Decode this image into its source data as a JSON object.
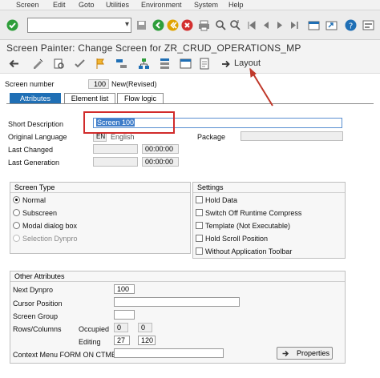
{
  "menu": [
    "Screen",
    "Edit",
    "Goto",
    "Utilities",
    "Environment",
    "System",
    "Help"
  ],
  "window_title": "Screen Painter: Change Screen for ZR_CRUD_OPERATIONS_MP",
  "toolbar2": {
    "layout_label": "Layout"
  },
  "header": {
    "screen_number_label": "Screen number",
    "screen_number_value": "100",
    "screen_status": "New(Revised)"
  },
  "tabs": [
    {
      "label": "Attributes",
      "active": true
    },
    {
      "label": "Element list",
      "active": false
    },
    {
      "label": "Flow logic",
      "active": false
    }
  ],
  "attributes": {
    "short_description_label": "Short Description",
    "short_description_value": "Screen 100",
    "original_language_label": "Original Language",
    "original_language_code": "EN",
    "original_language_name": "English",
    "package_label": "Package",
    "package_value": "",
    "last_changed_label": "Last Changed",
    "last_changed_date": "",
    "last_changed_time": "00:00:00",
    "last_generation_label": "Last Generation",
    "last_generation_date": "",
    "last_generation_time": "00:00:00"
  },
  "screen_type": {
    "title": "Screen Type",
    "options": [
      {
        "label": "Normal",
        "selected": true,
        "enabled": true
      },
      {
        "label": "Subscreen",
        "selected": false,
        "enabled": true
      },
      {
        "label": "Modal dialog box",
        "selected": false,
        "enabled": true
      },
      {
        "label": "Selection Dynpro",
        "selected": false,
        "enabled": false
      }
    ]
  },
  "settings": {
    "title": "Settings",
    "options": [
      {
        "label": "Hold Data",
        "checked": false
      },
      {
        "label": "Switch Off Runtime Compress",
        "checked": false
      },
      {
        "label": "Template (Not Executable)",
        "checked": false
      },
      {
        "label": "Hold Scroll Position",
        "checked": false
      },
      {
        "label": "Without Application Toolbar",
        "checked": false
      }
    ]
  },
  "other_attributes": {
    "title": "Other Attributes",
    "next_dynpro_label": "Next Dynpro",
    "next_dynpro_value": "100",
    "cursor_position_label": "Cursor Position",
    "cursor_position_value": "",
    "screen_group_label": "Screen Group",
    "screen_group_value": "",
    "rows_columns_label": "Rows/Columns",
    "occupied_label": "Occupied",
    "occupied_rows": "0",
    "occupied_cols": "0",
    "editing_label": "Editing",
    "editing_rows": "27",
    "editing_cols": "120",
    "context_menu_label": "Context Menu FORM ON CTMENU",
    "context_menu_value": "",
    "properties_label": "Properties"
  },
  "colors": {
    "active_tab": "#1f6fb5",
    "highlight_box": "#d12b2b",
    "arrow": "#c0392b"
  }
}
